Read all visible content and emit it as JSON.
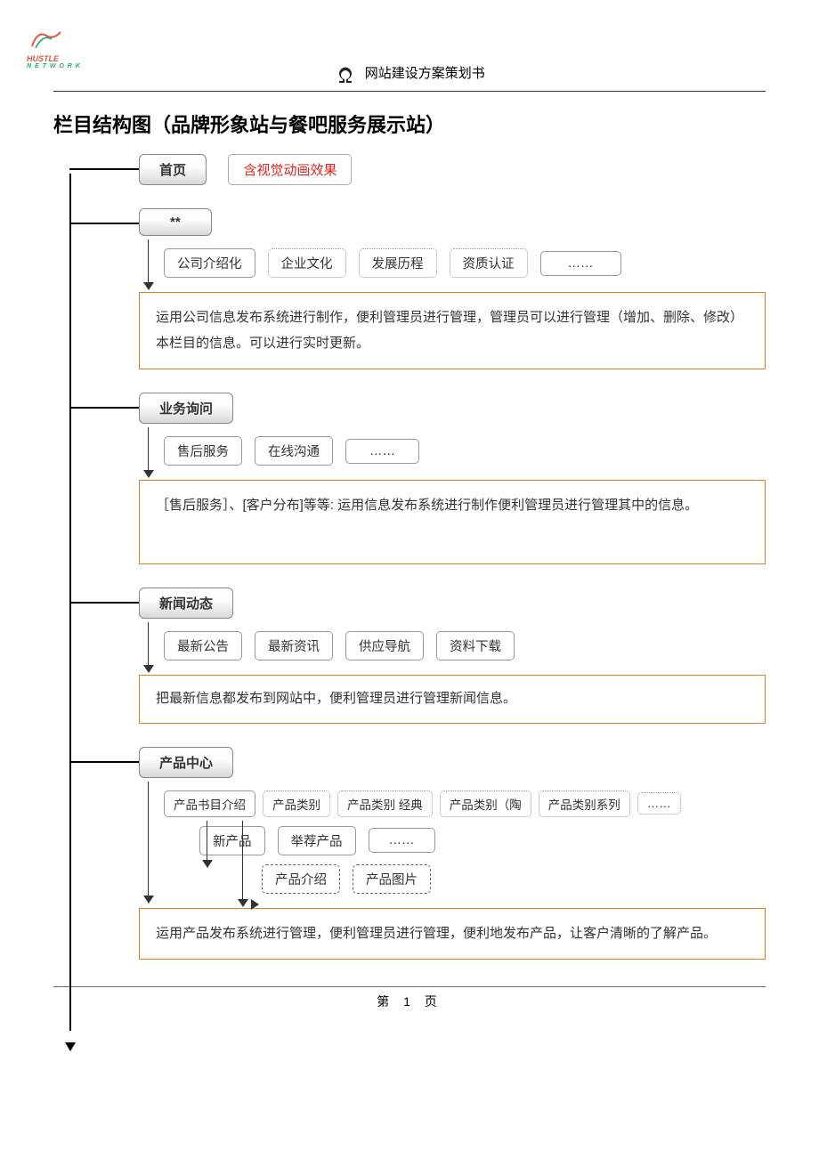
{
  "logo": {
    "line1": "HUSTLE",
    "line2": "N E T W O R K"
  },
  "header": {
    "title": "网站建设方案策划书"
  },
  "page_title": "栏目结构图（品牌形象站与餐吧服务展示站）",
  "home": {
    "label": "首页",
    "note": "含视觉动画效果"
  },
  "section_about": {
    "label": "**",
    "items": [
      "公司介绍化",
      "企业文化",
      "发展历程",
      "资质认证",
      "……"
    ],
    "desc": "运用公司信息发布系统进行制作，便利管理员进行管理，管理员可以进行管理（增加、删除、修改）本栏目的信息。可以进行实时更新。"
  },
  "section_biz": {
    "label": "业务询问",
    "items": [
      "售后服务",
      "在线沟通",
      "……"
    ],
    "desc": "［售后服务］、[客户分布]等等: 运用信息发布系统进行制作便利管理员进行管理其中的信息。"
  },
  "section_news": {
    "label": "新闻动态",
    "items": [
      "最新公告",
      "最新资讯",
      "供应导航",
      "资料下载"
    ],
    "desc": "把最新信息都发布到网站中，便利管理员进行管理新闻信息。"
  },
  "section_product": {
    "label": "产品中心",
    "row1": [
      "产品书目介绍",
      "产品类别",
      "产品类别 经典",
      "产品类别（陶",
      "产品类别系列",
      "……"
    ],
    "row2": [
      "新产品",
      "举荐产品",
      "……"
    ],
    "row3": [
      "产品介绍",
      "产品图片"
    ],
    "desc": "运用产品发布系统进行管理，便利管理员进行管理，便利地发布产品，让客户清晰的了解产品。"
  },
  "footer": {
    "page_label": "第",
    "page_num": "1",
    "page_suffix": "页"
  }
}
